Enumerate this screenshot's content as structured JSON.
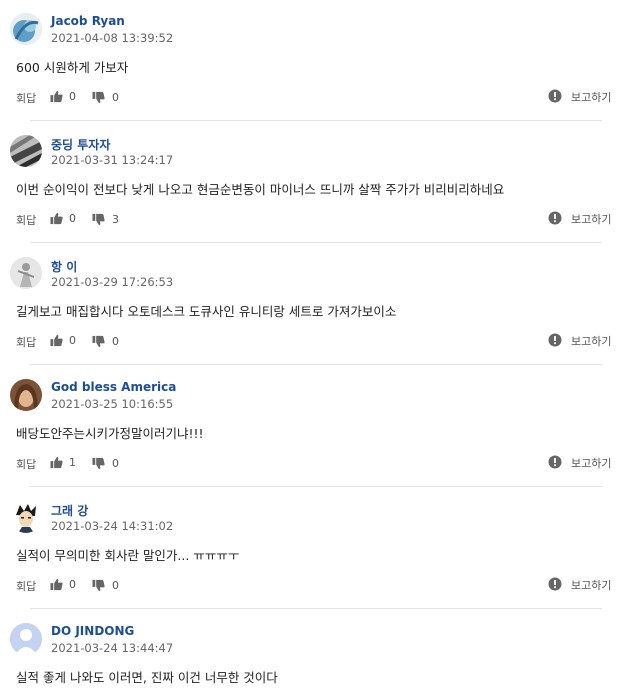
{
  "labels": {
    "reply": "회답",
    "report": "보고하기"
  },
  "comments": [
    {
      "author": "Jacob Ryan",
      "date": "2021-04-08 13:39:52",
      "text": "600 시원하게 가보자",
      "likes": "0",
      "dislikes": "0",
      "avatar_color": "#6aa7c9"
    },
    {
      "author": "중딩 투자자",
      "date": "2021-03-31 13:24:17",
      "text": "이번 순이익이 전보다 낮게 나오고 현금순변동이 마이너스 뜨니까 살짝 주가가 비리비리하네요",
      "likes": "0",
      "dislikes": "3",
      "avatar_color": "#5a5a5a"
    },
    {
      "author": "항 이",
      "date": "2021-03-29 17:26:53",
      "text": "길게보고 매집합시다 오토데스크 도큐사인 유니티랑 세트로 가져가보이소",
      "likes": "0",
      "dislikes": "0",
      "avatar_color": "#d9d9d9"
    },
    {
      "author": "God bless America",
      "date": "2021-03-25 10:16:55",
      "text": "배당도안주는시키가정말이러기냐!!!",
      "likes": "1",
      "dislikes": "0",
      "avatar_color": "#b07a55"
    },
    {
      "author": "그래 강",
      "date": "2021-03-24 14:31:02",
      "text": "실적이 무의미한 회사란 말인가... ㅠㅠㅠㅜ",
      "likes": "0",
      "dislikes": "0",
      "avatar_color": "#444444"
    },
    {
      "author": "DO JINDONG",
      "date": "2021-03-24 13:44:47",
      "text": "실적 좋게 나와도 이러면, 진짜 이건 너무한 것이다",
      "likes": "",
      "dislikes": "",
      "avatar_color": "#b8c8f0"
    }
  ]
}
